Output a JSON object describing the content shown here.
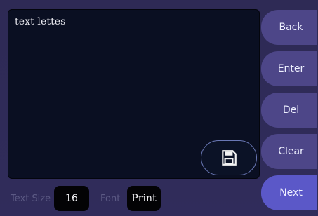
{
  "editor": {
    "text": "text lettes"
  },
  "sidebar": {
    "buttons": [
      {
        "label": "Back"
      },
      {
        "label": "Enter"
      },
      {
        "label": "Del"
      },
      {
        "label": "Clear"
      },
      {
        "label": "Next"
      }
    ]
  },
  "footer": {
    "text_size_label": "Text Size",
    "text_size_value": "16",
    "font_label": "Font",
    "font_value": "Print"
  },
  "icons": {
    "save": "save-icon"
  },
  "colors": {
    "background": "#2f2c57",
    "editor_bg": "#0a0f22",
    "side_button": "#4d4688",
    "next_button": "#5b58c8",
    "accent_outline": "#6a78b5"
  }
}
